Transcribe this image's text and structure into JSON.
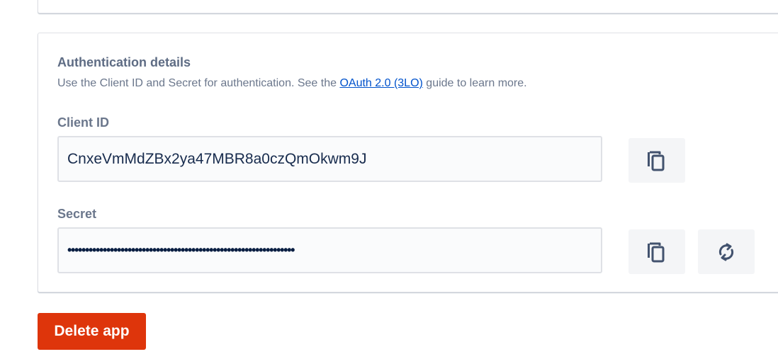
{
  "auth": {
    "title": "Authentication details",
    "description_prefix": "Use the Client ID and Secret for authentication. See the ",
    "description_link": "OAuth 2.0 (3LO)",
    "description_suffix": " guide to learn more.",
    "client_id_label": "Client ID",
    "client_id_value": "CnxeVmMdZBx2ya47MBR8a0czQmOkwm9J",
    "secret_label": "Secret",
    "secret_value": "••••••••••••••••••••••••••••••••••••••••••••••••••••••••••••••••",
    "icons": {
      "copy": "copy-icon",
      "regenerate": "refresh-icon"
    }
  },
  "actions": {
    "delete_label": "Delete app"
  },
  "colors": {
    "danger": "#de350b",
    "link": "#0052cc",
    "field_bg": "#fafbfc",
    "button_bg": "#f4f5f7"
  }
}
